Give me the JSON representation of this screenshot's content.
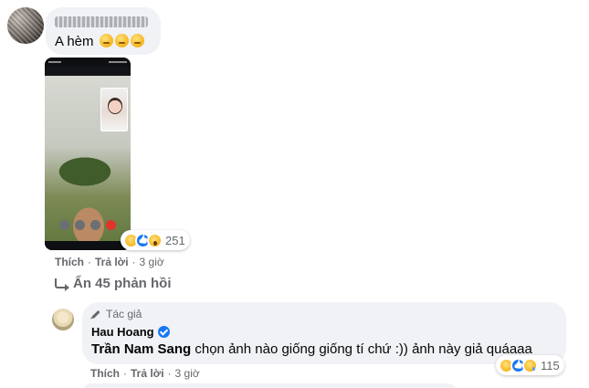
{
  "comment1": {
    "text": "A hèm",
    "reaction_count": "251",
    "reactions": [
      "haha-icon",
      "like-icon",
      "wow-icon"
    ],
    "actions": {
      "like": "Thích",
      "reply": "Trả lời",
      "time": "3 giờ"
    }
  },
  "replies_toggle": {
    "label": "Ẩn 45 phản hồi"
  },
  "reply1": {
    "author_tag": "Tác giả",
    "author_name": "Hau Hoang",
    "mention": "Trần Nam Sang",
    "text": " chọn ảnh nào giống giống tí chứ :)) ảnh này giả quáaaa",
    "reaction_count": "115",
    "reactions": [
      "haha-icon",
      "like-icon",
      "sad-icon"
    ],
    "actions": {
      "like": "Thích",
      "reply": "Trả lời",
      "time": "3 giờ"
    }
  },
  "colors": {
    "bubble": "#f0f2f5",
    "meta_text": "#65676b",
    "brand_blue": "#1877f2"
  }
}
